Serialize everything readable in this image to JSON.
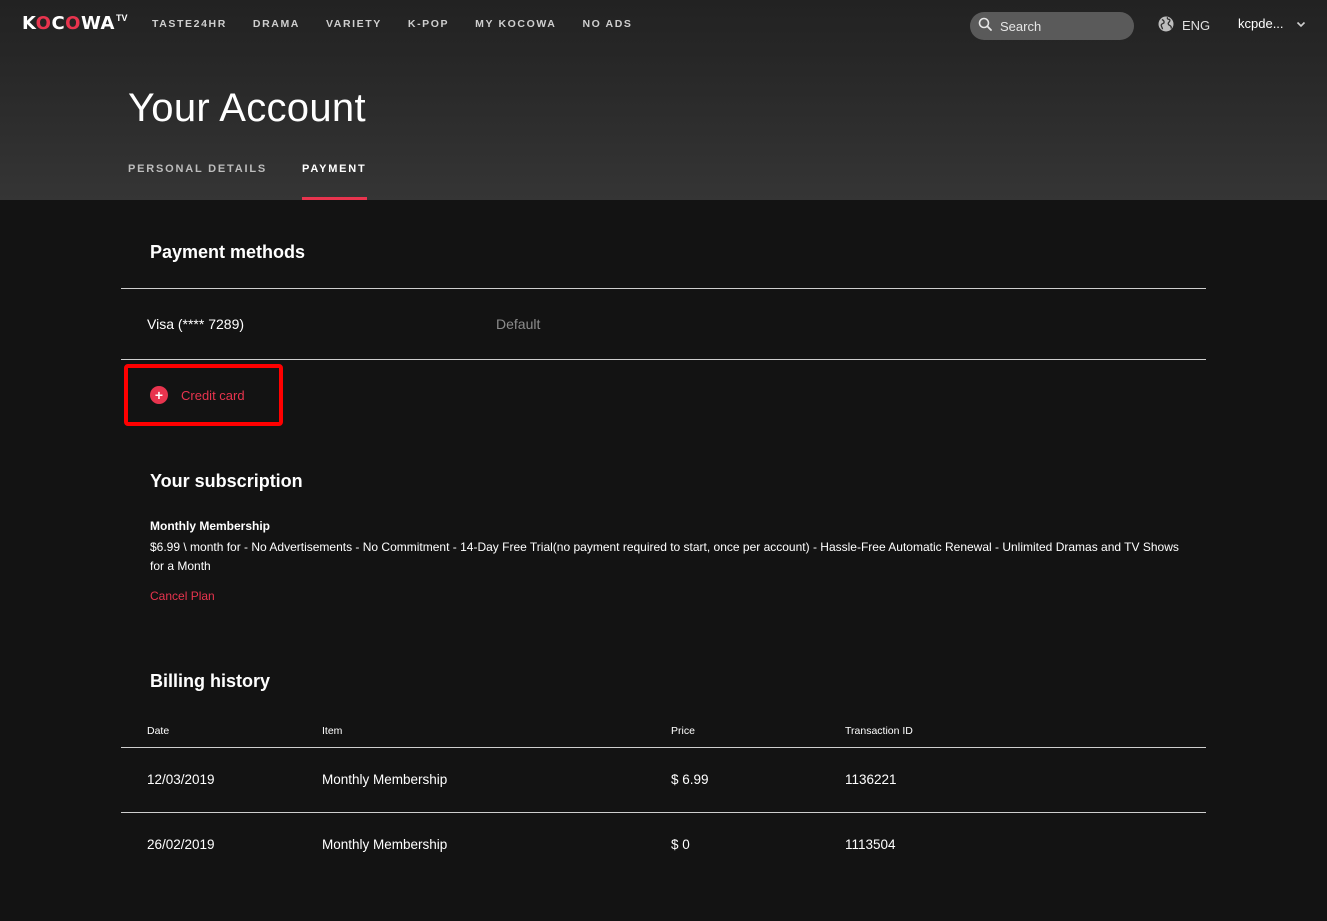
{
  "brand": {
    "logo_text_1": "K",
    "logo_o1": "O",
    "logo_text_2": "C",
    "logo_o2": "O",
    "logo_text_3": "WA",
    "logo_tv": "TV",
    "accent": "#e8344e"
  },
  "nav": {
    "items": [
      {
        "label": "TASTE24HR"
      },
      {
        "label": "DRAMA"
      },
      {
        "label": "VARIETY"
      },
      {
        "label": "K-POP"
      },
      {
        "label": "MY KOCOWA"
      },
      {
        "label": "NO ADS"
      }
    ]
  },
  "search": {
    "placeholder": "Search"
  },
  "language": {
    "label": "ENG"
  },
  "user": {
    "name": "kcpde..."
  },
  "page": {
    "title": "Your Account",
    "tabs": [
      {
        "label": "PERSONAL DETAILS",
        "active": false
      },
      {
        "label": "PAYMENT",
        "active": true
      }
    ]
  },
  "payment_methods": {
    "heading": "Payment methods",
    "card": {
      "name": "Visa (**** 7289)",
      "status": "Default"
    },
    "add_label": "Credit card"
  },
  "subscription": {
    "heading": "Your subscription",
    "plan_name": "Monthly Membership",
    "plan_description": "$6.99 \\ month for - No Advertisements - No Commitment - 14-Day Free Trial(no payment required to start, once per account) - Hassle-Free Automatic Renewal - Unlimited Dramas and TV Shows for a Month",
    "cancel_label": "Cancel Plan"
  },
  "billing": {
    "heading": "Billing history",
    "columns": [
      "Date",
      "Item",
      "Price",
      "Transaction ID"
    ],
    "rows": [
      {
        "date": "12/03/2019",
        "item": "Monthly Membership",
        "price": "$ 6.99",
        "transaction_id": "1136221"
      },
      {
        "date": "26/02/2019",
        "item": "Monthly Membership",
        "price": "$ 0",
        "transaction_id": "1113504"
      }
    ]
  }
}
